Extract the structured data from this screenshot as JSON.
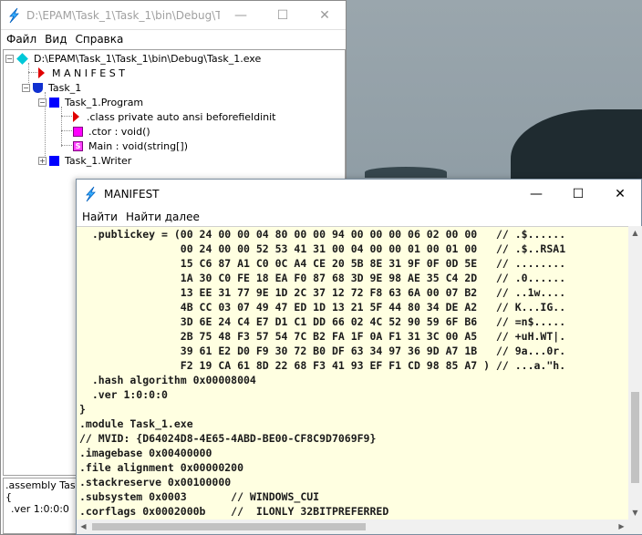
{
  "back_window": {
    "title": "D:\\EPAM\\Task_1\\Task_1\\bin\\Debug\\T...",
    "menu": [
      "Файл",
      "Вид",
      "Справка"
    ],
    "tree": {
      "root": "D:\\EPAM\\Task_1\\Task_1\\bin\\Debug\\Task_1.exe",
      "manifest": "M A N I F E S T",
      "namespace": "Task_1",
      "class_program": "Task_1.Program",
      "class_directive": ".class private auto ansi beforefieldinit",
      "ctor": ".ctor : void()",
      "main": "Main : void(string[])",
      "class_writer": "Task_1.Writer"
    },
    "assembly_pane": [
      ".assembly Task_",
      "{",
      "  .ver 1:0:0:0"
    ]
  },
  "front_window": {
    "title": "MANIFEST",
    "menu": [
      "Найти",
      "Найти далее"
    ],
    "code_lines": [
      "  .publickey = (00 24 00 00 04 80 00 00 94 00 00 00 06 02 00 00   // .$......",
      "                00 24 00 00 52 53 41 31 00 04 00 00 01 00 01 00   // .$..RSA1",
      "                15 C6 87 A1 C0 0C A4 CE 20 5B 8E 31 9F 0F 0D 5E   // ........",
      "                1A 30 C0 FE 18 EA F0 87 68 3D 9E 98 AE 35 C4 2D   // .0......",
      "                13 EE 31 77 9E 1D 2C 37 12 72 F8 63 6A 00 07 B2   // ..1w....",
      "                4B CC 03 07 49 47 ED 1D 13 21 5F 44 80 34 DE A2   // K...IG..",
      "                3D 6E 24 C4 E7 D1 C1 DD 66 02 4C 52 90 59 6F B6   // =n$.....",
      "                2B 75 48 F3 57 54 7C B2 FA 1F 0A F1 31 3C 00 A5   // +uH.WT|.",
      "                39 61 E2 D0 F9 30 72 B0 DF 63 34 97 36 9D A7 1B   // 9a...0r.",
      "                F2 19 CA 61 8D 22 68 F3 41 93 EF F1 CD 98 85 A7 ) // ...a.\"h.",
      "  .hash algorithm 0x00008004",
      "  .ver 1:0:0:0",
      "}",
      ".module Task_1.exe",
      "// MVID: {D64024D8-4E65-4ABD-BE00-CF8C9D7069F9}",
      ".imagebase 0x00400000",
      ".file alignment 0x00000200",
      ".stackreserve 0x00100000",
      ".subsystem 0x0003       // WINDOWS_CUI",
      ".corflags 0x0002000b    //  ILONLY 32BITPREFERRED"
    ]
  }
}
